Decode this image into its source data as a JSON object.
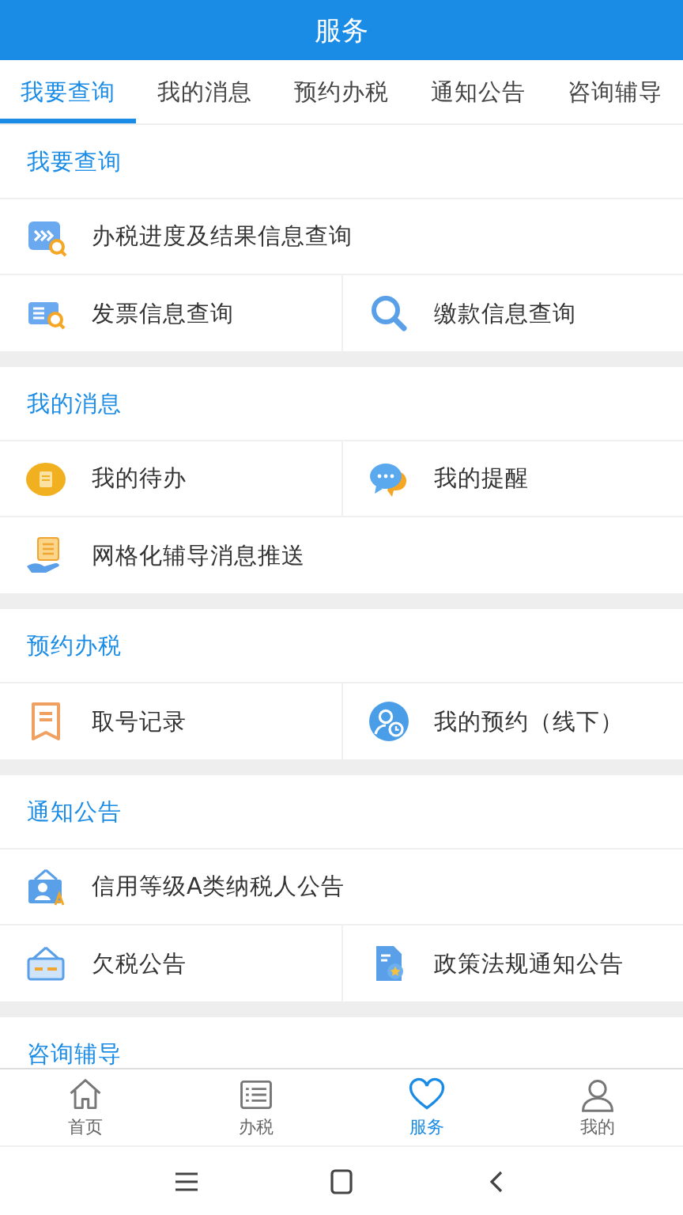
{
  "window": {
    "title": "服务"
  },
  "tabs": [
    {
      "label": "我要查询",
      "selected": true
    },
    {
      "label": "我的消息",
      "selected": false
    },
    {
      "label": "预约办税",
      "selected": false
    },
    {
      "label": "通知公告",
      "selected": false
    },
    {
      "label": "咨询辅导",
      "selected": false
    }
  ],
  "sections": [
    {
      "title": "我要查询",
      "rows": [
        [
          "办税进度及结果信息查询"
        ],
        [
          "发票信息查询",
          "缴款信息查询"
        ]
      ]
    },
    {
      "title": "我的消息",
      "rows": [
        [
          "我的待办",
          "我的提醒"
        ],
        [
          "网格化辅导消息推送"
        ]
      ]
    },
    {
      "title": "预约办税",
      "rows": [
        [
          "取号记录",
          "我的预约（线下）"
        ]
      ]
    },
    {
      "title": "通知公告",
      "rows": [
        [
          "信用等级A类纳税人公告"
        ],
        [
          "欠税公告",
          "政策法规通知公告"
        ]
      ]
    },
    {
      "title": "咨询辅导"
    }
  ],
  "bottom_nav": [
    {
      "label": "首页",
      "selected": false
    },
    {
      "label": "办税",
      "selected": false
    },
    {
      "label": "服务",
      "selected": true
    },
    {
      "label": "我的",
      "selected": false
    }
  ]
}
